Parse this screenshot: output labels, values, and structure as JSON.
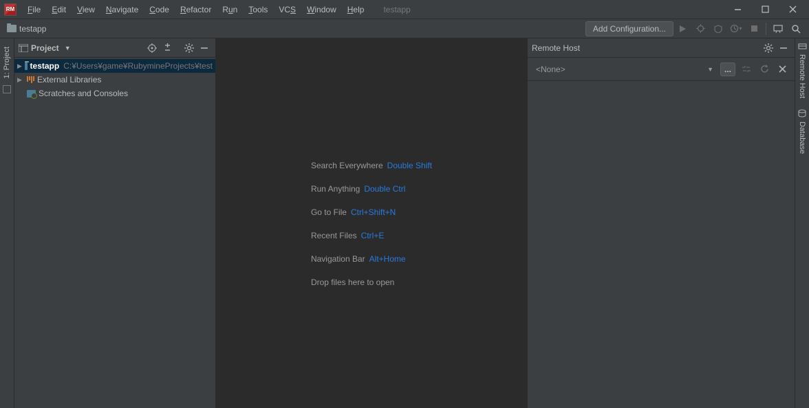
{
  "menu": {
    "items": [
      "File",
      "Edit",
      "View",
      "Navigate",
      "Code",
      "Refactor",
      "Run",
      "Tools",
      "VCS",
      "Window",
      "Help"
    ],
    "title": "testapp"
  },
  "toolbar": {
    "project_chip": "testapp",
    "add_config": "Add Configuration..."
  },
  "project_pane": {
    "title": "Project",
    "root_name": "testapp",
    "root_path": "C:¥Users¥game¥RubymineProjects¥test",
    "external_libs": "External Libraries",
    "scratches": "Scratches and Consoles"
  },
  "editor_tips": [
    {
      "label": "Search Everywhere",
      "shortcut": "Double Shift"
    },
    {
      "label": "Run Anything",
      "shortcut": "Double Ctrl"
    },
    {
      "label": "Go to File",
      "shortcut": "Ctrl+Shift+N"
    },
    {
      "label": "Recent Files",
      "shortcut": "Ctrl+E"
    },
    {
      "label": "Navigation Bar",
      "shortcut": "Alt+Home"
    },
    {
      "label": "Drop files here to open",
      "shortcut": ""
    }
  ],
  "remote_pane": {
    "title": "Remote Host",
    "combo_value": "<None>"
  },
  "gutter": {
    "left_label": "1: Project",
    "right_labels": [
      "Remote Host",
      "Database"
    ]
  }
}
